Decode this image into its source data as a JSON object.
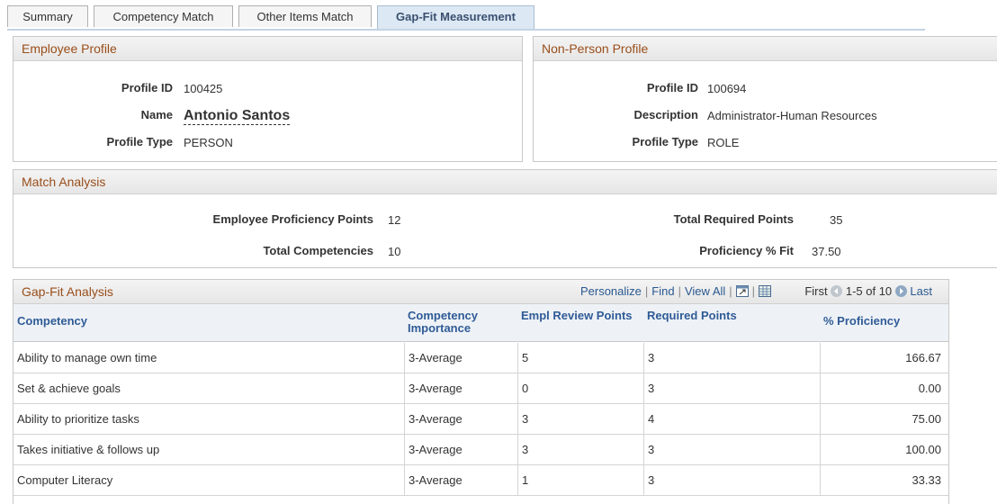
{
  "tabs": [
    "Summary",
    "Competency Match",
    "Other Items Match",
    "Gap-Fit Measurement"
  ],
  "employee_profile": {
    "title": "Employee Profile",
    "profile_id_label": "Profile ID",
    "profile_id": "100425",
    "name_label": "Name",
    "name": "Antonio Santos",
    "profile_type_label": "Profile Type",
    "profile_type": "PERSON"
  },
  "nonperson_profile": {
    "title": "Non-Person Profile",
    "profile_id_label": "Profile ID",
    "profile_id": "100694",
    "description_label": "Description",
    "description": "Administrator-Human Resources",
    "profile_type_label": "Profile Type",
    "profile_type": "ROLE"
  },
  "match_analysis": {
    "title": "Match Analysis",
    "emp_points_label": "Employee Proficiency Points",
    "emp_points": "12",
    "total_comp_label": "Total Competencies",
    "total_comp": "10",
    "total_req_label": "Total Required Points",
    "total_req": "35",
    "fit_label": "Proficiency % Fit",
    "fit": "37.50"
  },
  "gap_fit": {
    "title": "Gap-Fit Analysis",
    "nav": {
      "personalize": "Personalize",
      "find": "Find",
      "view_all": "View All",
      "first": "First",
      "range": "1-5 of 10",
      "last": "Last"
    },
    "columns": [
      "Competency",
      "Competency Importance",
      "Empl Review Points",
      "Required Points",
      "% Proficiency"
    ],
    "rows": [
      {
        "competency": "Ability to manage own time",
        "importance": "3-Average",
        "review": "5",
        "required": "3",
        "proficiency": "166.67"
      },
      {
        "competency": "Set & achieve goals",
        "importance": "3-Average",
        "review": "0",
        "required": "3",
        "proficiency": "0.00"
      },
      {
        "competency": "Ability to prioritize tasks",
        "importance": "3-Average",
        "review": "3",
        "required": "4",
        "proficiency": "75.00"
      },
      {
        "competency": "Takes initiative & follows up",
        "importance": "3-Average",
        "review": "3",
        "required": "3",
        "proficiency": "100.00"
      },
      {
        "competency": "Computer Literacy",
        "importance": "3-Average",
        "review": "1",
        "required": "3",
        "proficiency": "33.33"
      }
    ]
  },
  "icons": [
    "zoom-icon",
    "download-icon",
    "first-arrow-icon",
    "next-arrow-icon"
  ]
}
